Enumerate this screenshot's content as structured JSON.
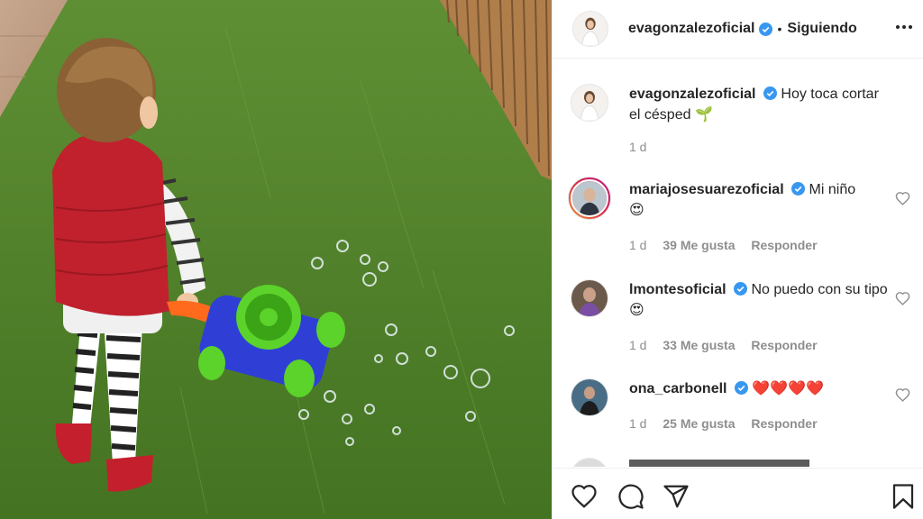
{
  "post": {
    "username": "evagonzalezoficial",
    "follow_status": "Siguiendo",
    "separator": "•",
    "more_icon": "more-horizontal-icon"
  },
  "caption": {
    "username": "evagonzalezoficial",
    "text": "Hoy toca cortar el césped",
    "emoji": "🌱",
    "time": "1 d"
  },
  "comments": [
    {
      "username": "mariajosesuarezoficial",
      "text": "Mi niño",
      "emoji": "😍",
      "time": "1 d",
      "likes": "39 Me gusta",
      "reply": "Responder"
    },
    {
      "username": "lmontesoficial",
      "text": "No puedo con su tipo",
      "emoji": "😍",
      "time": "1 d",
      "likes": "33 Me gusta",
      "reply": "Responder"
    },
    {
      "username": "ona_carbonell",
      "text": "",
      "emoji": "❤️❤️❤️❤️",
      "time": "1 d",
      "likes": "25 Me gusta",
      "reply": "Responder"
    }
  ],
  "actions": {
    "like_icon": "heart-icon",
    "comment_icon": "comment-icon",
    "share_icon": "share-icon",
    "save_icon": "bookmark-icon"
  },
  "colors": {
    "verified": "#3897f0",
    "text": "#262626",
    "muted": "#8e8e8e",
    "border": "#efefef"
  }
}
